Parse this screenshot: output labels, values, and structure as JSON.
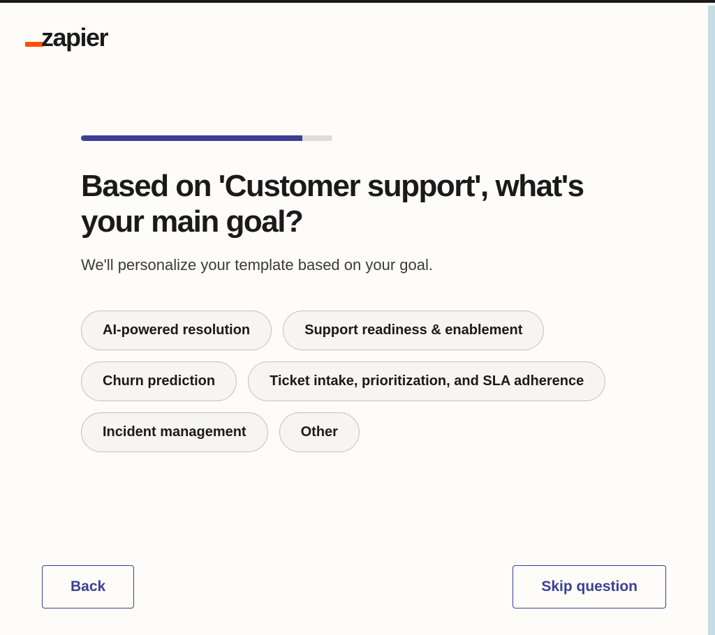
{
  "logo": {
    "text": "zapier"
  },
  "progress": {
    "percent": 88
  },
  "heading": "Based on 'Customer support', what's your main goal?",
  "subheading": "We'll personalize your template based on your goal.",
  "options": [
    "AI-powered resolution",
    "Support readiness & enablement",
    "Churn prediction",
    "Ticket intake, prioritization, and SLA adherence",
    "Incident management",
    "Other"
  ],
  "footer": {
    "back": "Back",
    "skip": "Skip question"
  }
}
